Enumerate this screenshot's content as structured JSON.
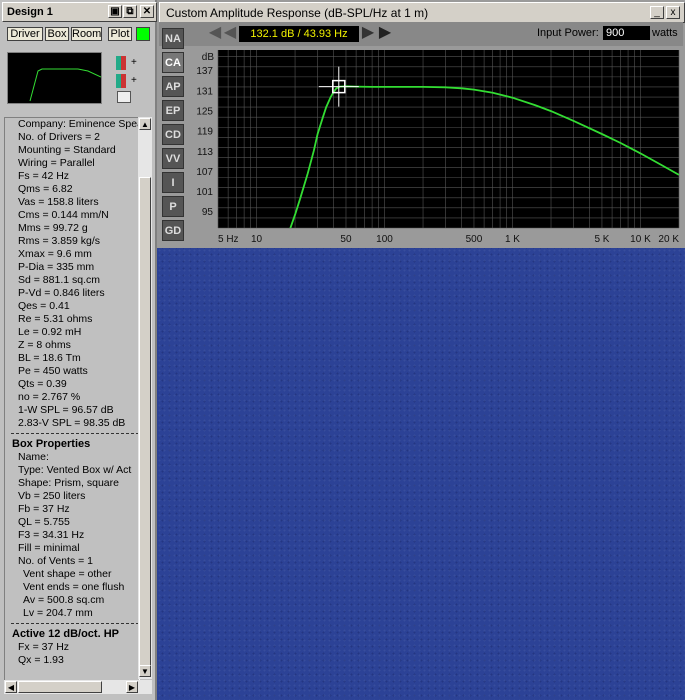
{
  "left_window": {
    "title": "Design 1",
    "tabs": [
      "Driver",
      "Box",
      "Room",
      "Plot"
    ],
    "thumb_controls": [
      "+",
      "+"
    ],
    "indicator_color": "#00ff00"
  },
  "driver_lines": [
    "Company: Eminence Spea",
    "No. of Drivers = 2",
    "Mounting = Standard",
    "Wiring = Parallel",
    "Fs = 42 Hz",
    "Qms = 6.82",
    "Vas = 158.8 liters",
    "Cms = 0.144 mm/N",
    "Mms = 99.72 g",
    "Rms = 3.859 kg/s",
    "Xmax = 9.6 mm",
    "P-Dia = 335 mm",
    "Sd = 881.1 sq.cm",
    "P-Vd = 0.846 liters",
    "Qes = 0.41",
    "Re = 5.31 ohms",
    "Le = 0.92 mH",
    "Z = 8 ohms",
    "BL = 18.6 Tm",
    "Pe = 450 watts",
    "Qts = 0.39",
    "no = 2.767 %",
    "1-W SPL = 96.57 dB",
    "2.83-V SPL = 98.35 dB"
  ],
  "box_properties": {
    "heading": "Box Properties",
    "lines": [
      "Name:",
      "Type: Vented Box w/ Act",
      "Shape: Prism, square",
      "Vb = 250 liters",
      "Fb = 37 Hz",
      "QL = 5.755",
      "F3 = 34.31 Hz",
      "Fill = minimal",
      "No. of Vents = 1"
    ],
    "sub_lines": [
      "Vent shape = other",
      "Vent ends = one flush",
      "Av = 500.8 sq.cm",
      "Lv = 204.7 mm"
    ]
  },
  "active_filter": {
    "heading": "Active 12 dB/oct. HP",
    "lines": [
      "Fx = 37 Hz",
      "Qx = 1.93"
    ]
  },
  "plot_window": {
    "title": "Custom Amplitude Response (dB-SPL/Hz at 1 m)",
    "readout": "132.1 dB / 43.93 Hz",
    "input_power_label": "Input Power:",
    "input_power_value": "900",
    "input_power_unit": "watts",
    "side_buttons": [
      "NA",
      "CA",
      "AP",
      "EP",
      "CD",
      "VV",
      "I",
      "P",
      "GD"
    ],
    "active_side_button": "CA",
    "window_buttons": [
      "_",
      "x"
    ]
  },
  "chart_data": {
    "type": "line",
    "title": "Custom Amplitude Response (dB-SPL/Hz at 1 m)",
    "xlabel": "",
    "ylabel": "dB",
    "x_scale": "log",
    "xlim": [
      5,
      20000
    ],
    "ylim": [
      90,
      143
    ],
    "x_ticks": [
      5,
      10,
      50,
      100,
      500,
      1000,
      5000,
      10000,
      20000
    ],
    "x_tick_labels": [
      "5 Hz",
      "10",
      "50",
      "100",
      "500",
      "1 K",
      "5 K",
      "10 K",
      "20 K"
    ],
    "y_ticks": [
      95,
      101,
      107,
      113,
      119,
      125,
      131,
      137
    ],
    "y_tick_labels": [
      "95",
      "101",
      "107",
      "113",
      "119",
      "125",
      "131",
      "137"
    ],
    "grid": true,
    "line_color": "#33dd33",
    "background": "#000000",
    "series": [
      {
        "x": [
          18,
          20,
          22,
          25,
          28,
          30,
          33,
          35,
          38,
          40,
          42,
          45,
          50,
          60,
          80,
          100,
          150,
          200,
          300,
          400,
          500,
          700,
          1000,
          1500,
          2000,
          3000,
          5000,
          7000,
          10000,
          15000,
          20000
        ],
        "y": [
          89,
          94,
          99,
          106,
          113,
          118,
          123,
          126,
          129,
          130.5,
          131.6,
          132.1,
          132.2,
          132.1,
          132.0,
          132.0,
          132.0,
          132.0,
          131.9,
          131.6,
          131.2,
          130.3,
          128.8,
          126.6,
          124.8,
          121.9,
          118.0,
          115.3,
          112.2,
          108.5,
          105.8
        ]
      }
    ],
    "cursor": {
      "x": 43.93,
      "y": 132.1
    }
  }
}
